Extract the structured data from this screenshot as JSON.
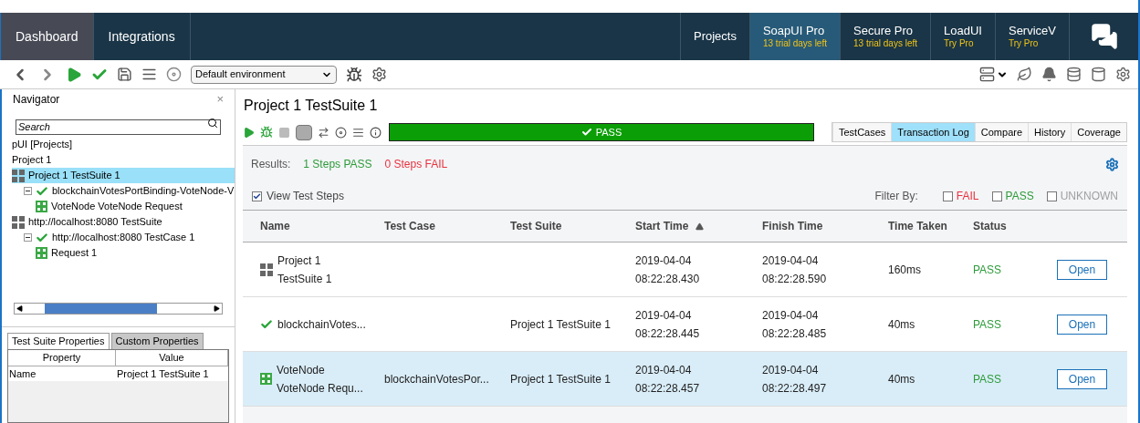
{
  "nav_tabs_left": [
    {
      "label": "Dashboard",
      "selected": true
    },
    {
      "label": "Integrations",
      "selected": false
    }
  ],
  "nav_tabs_right": [
    {
      "label": "Projects",
      "highlighted": false
    },
    {
      "label": "SoapUI Pro",
      "subtitle": "13 trial days left",
      "highlighted": true
    },
    {
      "label": "Secure Pro",
      "subtitle": "13 trial days left",
      "highlighted": false
    },
    {
      "label": "LoadUI",
      "subtitle": "Try Pro",
      "highlighted": false
    },
    {
      "label": "ServiceV",
      "subtitle": "Try Pro",
      "highlighted": false
    }
  ],
  "toolbar": {
    "environment": "Default environment"
  },
  "navigator": {
    "title": "Navigator",
    "close": "×",
    "search": {
      "placeholder": "Search"
    },
    "tree": [
      {
        "label": "pUI [Projects]",
        "kind": "text",
        "selected": false
      },
      {
        "label": "Project 1",
        "kind": "text",
        "selected": false
      },
      {
        "label": "Project 1 TestSuite 1",
        "kind": "suite",
        "selected": true,
        "children": [
          {
            "label": "blockchainVotesPortBinding-VoteNode-V",
            "kind": "testcase",
            "selected": false,
            "expanded": true,
            "children": [
              {
                "label": "VoteNode VoteNode Request",
                "kind": "request",
                "selected": false
              }
            ]
          }
        ]
      },
      {
        "label": "http://localhost:8080 TestSuite",
        "kind": "suite",
        "selected": false,
        "children": [
          {
            "label": "http://localhost:8080 TestCase 1",
            "kind": "testcase",
            "selected": false,
            "expanded": true,
            "children": [
              {
                "label": "Request 1",
                "kind": "request",
                "selected": false
              }
            ]
          }
        ]
      }
    ]
  },
  "properties": {
    "tabs": [
      {
        "label": "Test Suite Properties",
        "selected": true
      },
      {
        "label": "Custom Properties",
        "selected": false
      }
    ],
    "columns": [
      "Property",
      "Value"
    ],
    "rows": [
      [
        "Name",
        "Project 1 TestSuite 1"
      ]
    ]
  },
  "editor": {
    "title": "Project 1 TestSuite 1",
    "status": "PASS",
    "view_tabs": [
      {
        "label": "TestCases",
        "selected": false
      },
      {
        "label": "Transaction Log",
        "selected": true
      },
      {
        "label": "Compare",
        "selected": false
      },
      {
        "label": "History",
        "selected": false
      },
      {
        "label": "Coverage",
        "selected": false
      }
    ],
    "results_label": "Results:",
    "pass_count": "1 Steps PASS",
    "fail_count": "0 Steps FAIL",
    "view_test_steps": {
      "label": "View Test Steps",
      "checked": true
    },
    "filter_label": "Filter By:",
    "filters": [
      {
        "label": "FAIL",
        "checked": false,
        "color": "#e8333f"
      },
      {
        "label": "PASS",
        "checked": false,
        "color": "#2e9b3a"
      },
      {
        "label": "UNKNOWN",
        "checked": false,
        "color": "#a0a0a0"
      }
    ],
    "columns": [
      {
        "label": "Name",
        "sorted": false
      },
      {
        "label": "Test Case",
        "sorted": false
      },
      {
        "label": "Test Suite",
        "sorted": false
      },
      {
        "label": "Start Time",
        "sorted": true
      },
      {
        "label": "Finish Time",
        "sorted": false
      },
      {
        "label": "Time Taken",
        "sorted": false
      },
      {
        "label": "Status",
        "sorted": false
      }
    ],
    "rows": [
      {
        "kind": "suite",
        "name": "Project 1\nTestSuite 1",
        "test_case": null,
        "test_suite": null,
        "start": "2019-04-04\n08:22:28.430",
        "finish": "2019-04-04\n08:22:28.590",
        "time": "160ms",
        "status": "PASS",
        "action": "Open",
        "selected": false
      },
      {
        "kind": "testcase",
        "name": "blockchainVotes...",
        "test_case": null,
        "test_suite": "Project 1 TestSuite 1",
        "start": "2019-04-04\n08:22:28.445",
        "finish": "2019-04-04\n08:22:28.485",
        "time": "40ms",
        "status": "PASS",
        "action": "Open",
        "selected": false
      },
      {
        "kind": "request",
        "name": "VoteNode\nVoteNode Requ...",
        "test_case": "blockchainVotesPor...",
        "test_suite": "Project 1 TestSuite 1",
        "start": "2019-04-04\n08:22:28.457",
        "finish": "2019-04-04\n08:22:28.497",
        "time": "40ms",
        "status": "PASS",
        "action": "Open",
        "selected": true
      }
    ]
  }
}
